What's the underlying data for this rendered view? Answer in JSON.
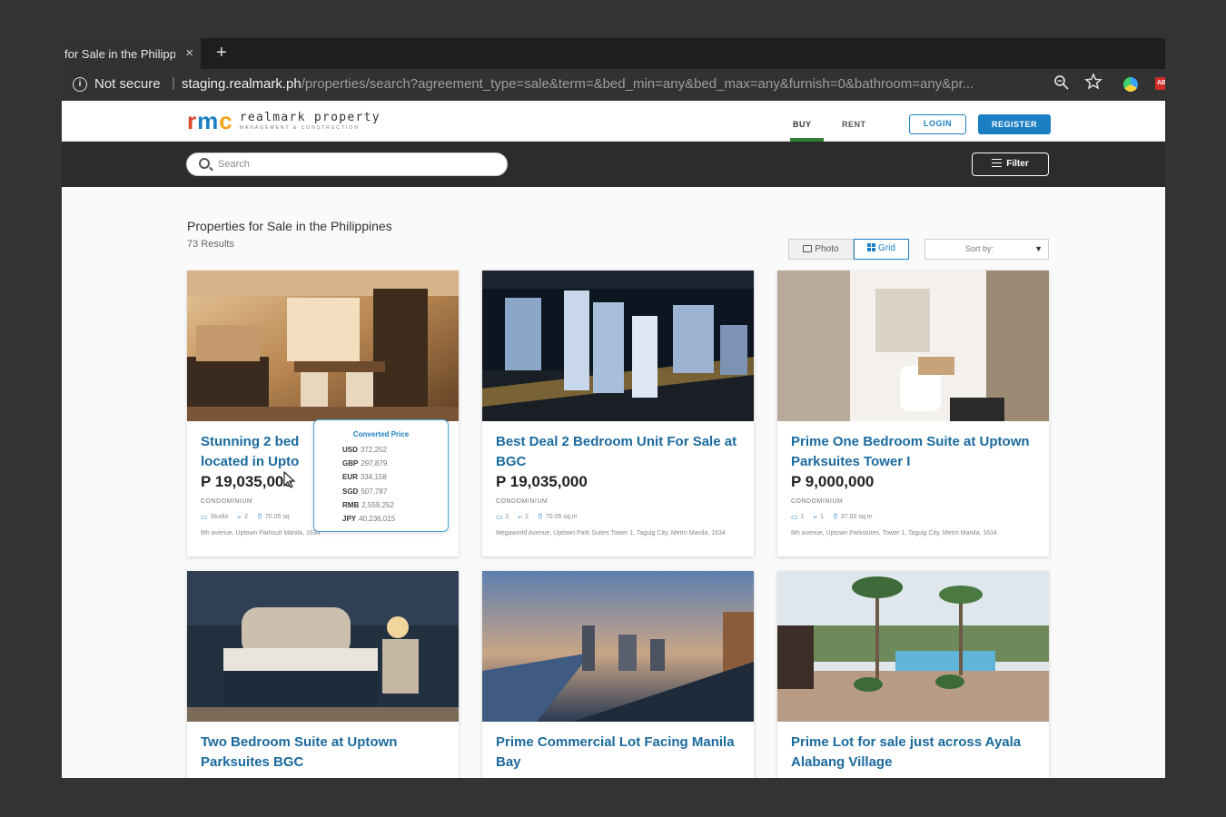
{
  "browser": {
    "tab_title": "for Sale in the Philippines",
    "tab_close": "×",
    "new_tab": "+",
    "security_label": "Not secure",
    "url_host": "staging.realmark.ph",
    "url_path": "/properties/search?agreement_type=sale&term=&bed_min=any&bed_max=any&furnish=0&bathroom=any&pr...",
    "ext_badge": "AB"
  },
  "header": {
    "logo_mark": [
      "r",
      "m",
      "c"
    ],
    "logo_name": "realmark property",
    "logo_sub": "MANAGEMENT & CONSTRUCTION",
    "nav_buy": "BUY",
    "nav_rent": "RENT",
    "login": "LOGIN",
    "register": "REGISTER"
  },
  "search": {
    "placeholder": "Search",
    "filter_label": "Filter"
  },
  "listing": {
    "heading": "Properties for Sale in the Philippines",
    "results": "73 Results",
    "view_photo": "Photo",
    "view_grid": "Grid",
    "sort_label": "Sort by:",
    "sort_arrow": "▼"
  },
  "converted_price": {
    "title": "Converted Price",
    "rows": [
      {
        "code": "USD",
        "value": "372,252"
      },
      {
        "code": "GBP",
        "value": "297,879"
      },
      {
        "code": "EUR",
        "value": "334,158"
      },
      {
        "code": "SGD",
        "value": "507,787"
      },
      {
        "code": "RMB",
        "value": "2,559,252"
      },
      {
        "code": "JPY",
        "value": "40,236,015"
      }
    ]
  },
  "cards": [
    {
      "title": "Stunning 2 bed located in Upto",
      "price": "P 19,035,000",
      "type": "CONDOMINIUM",
      "beds": "Studio",
      "baths": "2",
      "area": "70.05 sq",
      "address": "8th avenue, Uptown Parksuit Manila, 1634",
      "image": "condo-kitchen-dining"
    },
    {
      "title": "Best Deal 2 Bedroom Unit For Sale at BGC",
      "price": "P 19,035,000",
      "type": "CONDOMINIUM",
      "beds": "2",
      "baths": "2",
      "area": "70.05 sq.m",
      "address": "Megaworld Avenue, Uptown Park Suites Tower 1, Taguig City, Metro Manila, 1634",
      "image": "night-city-towers"
    },
    {
      "title": "Prime One Bedroom Suite at Uptown Parksuites Tower I",
      "price": "P 9,000,000",
      "type": "CONDOMINIUM",
      "beds": "1",
      "baths": "1",
      "area": "37.00 sq.m",
      "address": "8th avenue, Uptown Parksiutes, Tower 1, Taguig City, Metro Manila, 1634",
      "image": "bathroom-suite"
    },
    {
      "title": "Two Bedroom Suite at Uptown Parksuites BGC",
      "image": "bedroom"
    },
    {
      "title": "Prime Commercial Lot Facing Manila Bay",
      "image": "bay-skyline"
    },
    {
      "title": "Prime Lot for sale just across Ayala Alabang Village",
      "image": "pool-palms"
    }
  ]
}
